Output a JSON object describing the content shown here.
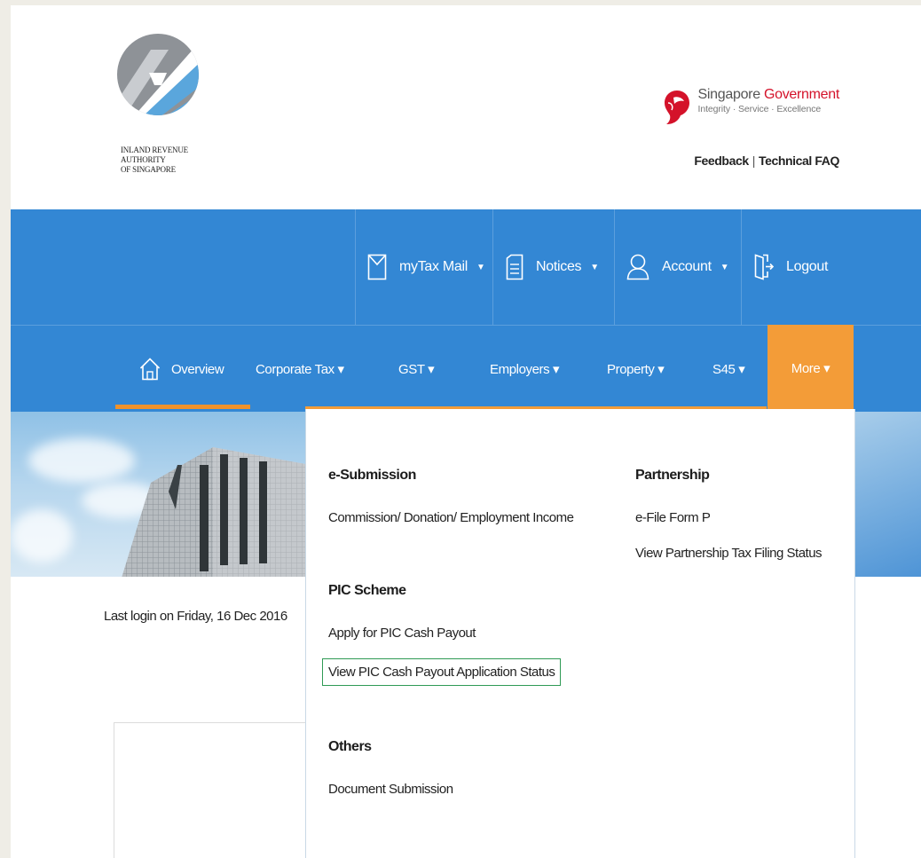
{
  "header": {
    "logo_lines": [
      "INLAND REVENUE",
      "AUTHORITY",
      "OF SINGAPORE"
    ],
    "govt_name_part1": "Singapore ",
    "govt_name_part2": "Government",
    "govt_tagline": "Integrity · Service · Excellence",
    "feedback": "Feedback",
    "separator": "|",
    "technical_faq": "Technical FAQ"
  },
  "topbar": {
    "mytaxmail": "myTax Mail",
    "notices": "Notices",
    "account": "Account",
    "logout": "Logout",
    "caret": "▼"
  },
  "nav": {
    "overview": "Overview",
    "corporate_tax": "Corporate Tax ▾",
    "gst": "GST ▾",
    "employers": "Employers ▾",
    "property": "Property ▾",
    "s45": "S45 ▾",
    "more": "More ▾"
  },
  "main": {
    "last_login": "Last login on Friday, 16 Dec 2016"
  },
  "dropdown": {
    "esubmission": {
      "heading": "e-Submission",
      "items": [
        "Commission/ Donation/ Employment Income"
      ]
    },
    "pic": {
      "heading": "PIC Scheme",
      "items": [
        "Apply for PIC Cash Payout",
        "View PIC Cash Payout Application Status"
      ]
    },
    "others": {
      "heading": "Others",
      "items": [
        "Document Submission"
      ]
    },
    "partnership": {
      "heading": "Partnership",
      "items": [
        "e-File Form P",
        "View Partnership Tax Filing Status"
      ]
    }
  },
  "colors": {
    "bar_blue": "#3387d4",
    "more_orange": "#f39c38",
    "focus_green": "#2f9a55",
    "govt_red": "#d4122a"
  }
}
